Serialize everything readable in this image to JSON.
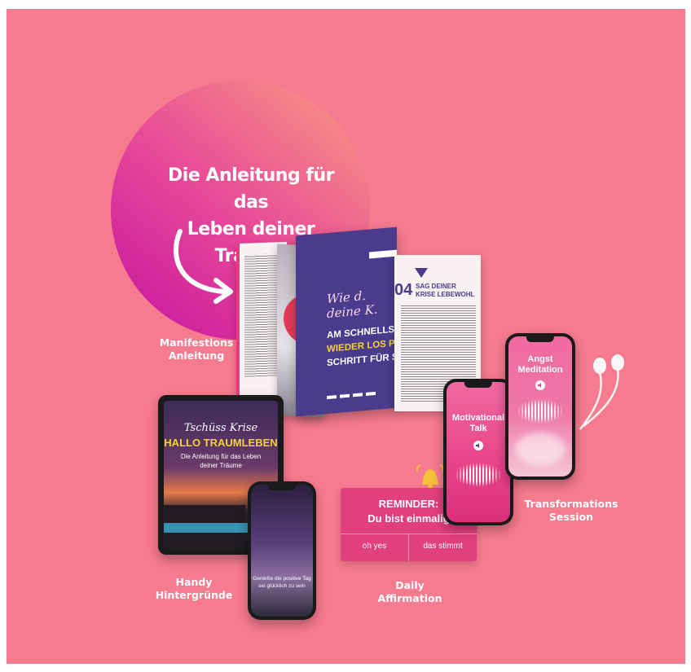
{
  "headline": {
    "line1": "Die Anleitung für das",
    "line2": "Leben deiner Träume"
  },
  "labels": {
    "manifest": [
      "Manifestions",
      "Anleitung"
    ],
    "handy": [
      "Handy",
      "Hintergründe"
    ],
    "daily": [
      "Daily",
      "Affirmation"
    ],
    "transform": [
      "Transformations",
      "Session"
    ]
  },
  "booklet": {
    "chapter_num": "04",
    "chapter_title_1": "SAG DEINER",
    "chapter_title_2": "KRISE LEBEWOHL",
    "cover_script": "Wie d. deine K.",
    "cover_line1": "AM SCHNELLS",
    "cover_line2": "WIEDER LOS P",
    "cover_line3": "SCHRITT FÜR S"
  },
  "tablet": {
    "script": "Tschüss Krise",
    "title": "HALLO TRAUMLEBEN",
    "sub1": "Die Anleitung für das Leben",
    "sub2": "deiner Träume"
  },
  "phone_wallpaper": {
    "quote_line1": "Genieße die positive Tag",
    "quote_line2": "sei glücklich zu sein"
  },
  "motivational": {
    "title1": "Motivational",
    "title2": "Talk"
  },
  "meditation": {
    "title1": "Angst",
    "title2": "Meditation"
  },
  "reminder": {
    "title": "REMINDER:",
    "subtitle": "Du bist einmalig",
    "btn1": "oh yes",
    "btn2": "das stimmt"
  },
  "colors": {
    "background": "#f77b8f",
    "accent_purple": "#4a3b8c",
    "accent_pink": "#e23f7d"
  },
  "icons": [
    "curved-arrow-icon",
    "speaker-icon",
    "bell-icon",
    "earphones-icon"
  ]
}
